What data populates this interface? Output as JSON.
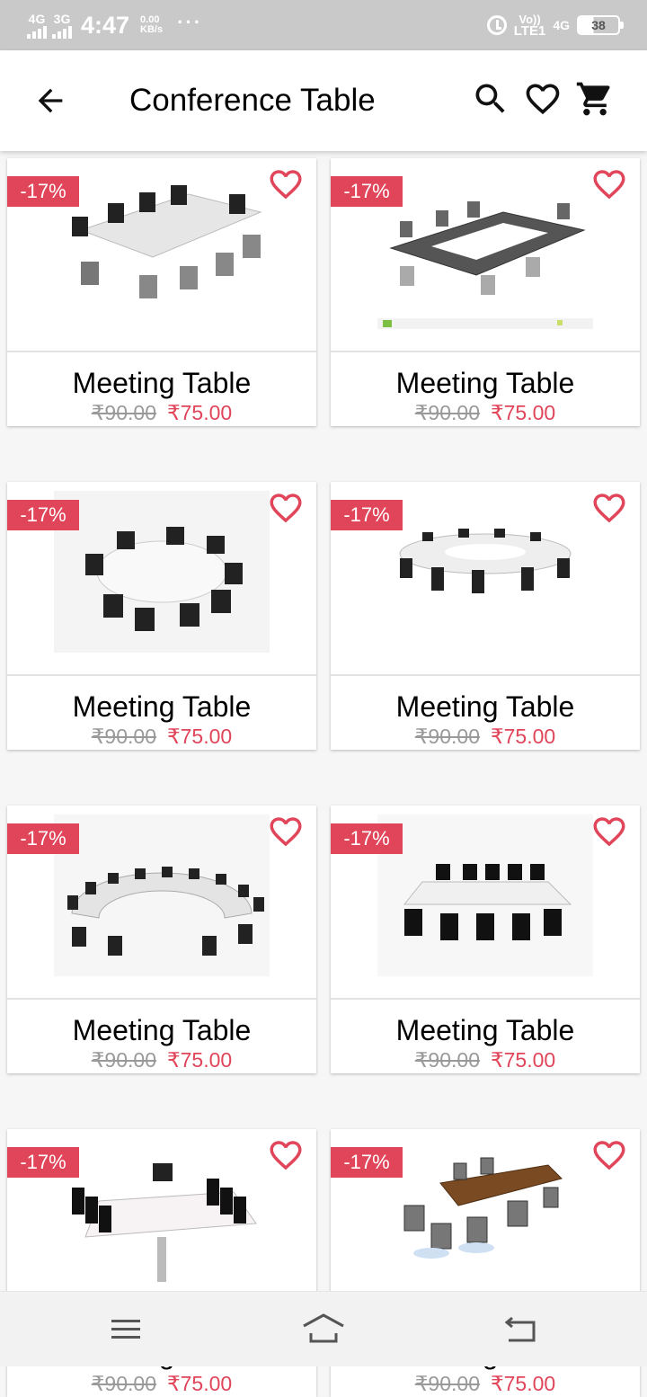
{
  "status_bar": {
    "sim1": "4G",
    "sim2": "3G",
    "time": "4:47",
    "speed_value": "0.00",
    "speed_unit": "KB/s",
    "more": "···",
    "volte": "Vo))",
    "lte": "LTE1",
    "network": "4G",
    "battery": "38"
  },
  "app_bar": {
    "title": "Conference Table",
    "icons": [
      "back-arrow-icon",
      "search-icon",
      "heart-outline-icon",
      "cart-icon"
    ]
  },
  "products": [
    {
      "discount": "-17%",
      "name": "Meeting Table",
      "old_price": "₹90.00",
      "new_price": "₹75.00",
      "image": "rectangular conference table with black chairs"
    },
    {
      "discount": "-17%",
      "name": "Meeting Table",
      "old_price": "₹90.00",
      "new_price": "₹75.00",
      "image": "hollow square conference table"
    },
    {
      "discount": "-17%",
      "name": "Meeting Table",
      "old_price": "₹90.00",
      "new_price": "₹75.00",
      "image": "round conference table"
    },
    {
      "discount": "-17%",
      "name": "Meeting Table",
      "old_price": "₹90.00",
      "new_price": "₹75.00",
      "image": "ring conference table"
    },
    {
      "discount": "-17%",
      "name": "Meeting Table",
      "old_price": "₹90.00",
      "new_price": "₹75.00",
      "image": "semicircle conference table"
    },
    {
      "discount": "-17%",
      "name": "Meeting Table",
      "old_price": "₹90.00",
      "new_price": "₹75.00",
      "image": "white meeting table"
    },
    {
      "discount": "-17%",
      "name": "Meeting Table",
      "old_price": "₹90.00",
      "new_price": "₹75.00",
      "image": "white boardroom table"
    },
    {
      "discount": "-17%",
      "name": "Meeting Table",
      "old_price": "₹90.00",
      "new_price": "₹75.00",
      "image": "wooden meeting table"
    }
  ],
  "colors": {
    "accent": "#e0455a",
    "status_bar": "#c9c9c9",
    "old_price": "#9a9a9a"
  },
  "nav_bar": {
    "icons": [
      "menu-icon",
      "home-icon",
      "back-icon"
    ]
  }
}
